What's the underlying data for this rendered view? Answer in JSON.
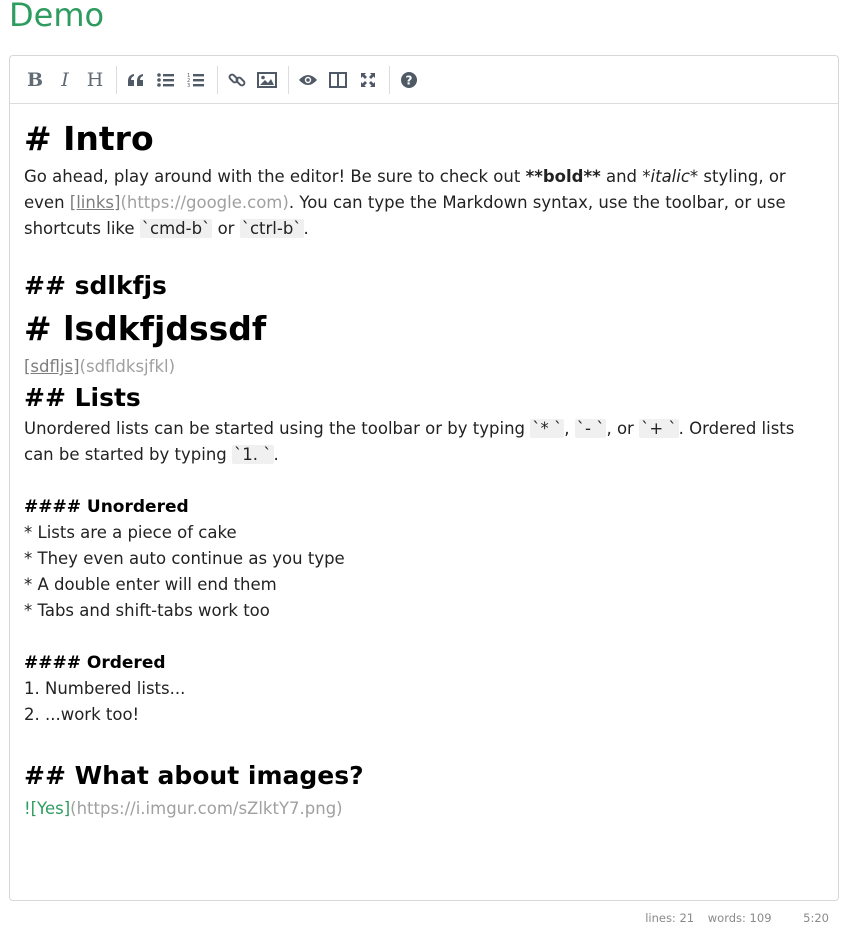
{
  "page": {
    "title": "Demo"
  },
  "toolbar": {
    "bold": "B",
    "italic": "I",
    "heading": "H"
  },
  "editor": {
    "intro_h1": "# Intro",
    "intro_p": {
      "a": "Go ahead, play around with the editor! Be sure to check out ",
      "bold": "**bold**",
      "b": " and ",
      "italic": "*italic*",
      "c": " styling, or even ",
      "link_text": "[links]",
      "link_url": "(https://google.com)",
      "d": ". You can type the Markdown syntax, use the toolbar, or use shortcuts like ",
      "code1": "`cmd-b`",
      "e": " or ",
      "code2": "`ctrl-b`",
      "f": "."
    },
    "h2_sdlkfjs": "## sdlkfjs",
    "h1_lsdk": "# lsdkfjdssdf",
    "link2_text": "[sdfljs]",
    "link2_url": "(sdfldksjfkl)",
    "lists_h2": "## Lists",
    "lists_p": {
      "a": "Unordered lists can be started using the toolbar or by typing ",
      "c1": "`* `",
      "b": ", ",
      "c2": "`- `",
      "c": ", or ",
      "c3": "`+ `",
      "d": ". Ordered lists can be started by typing ",
      "c4": "`1. `",
      "e": "."
    },
    "unordered_h4": "#### Unordered",
    "unordered_items": [
      "* Lists are a piece of cake",
      "* They even auto continue as you type",
      "* A double enter will end them",
      "* Tabs and shift-tabs work too"
    ],
    "ordered_h4": "#### Ordered",
    "ordered_items": [
      "1. Numbered lists...",
      "2. ...work too!"
    ],
    "images_h2": "## What about images?",
    "image_bang": "!",
    "image_alt": "[Yes]",
    "image_url": "(https://i.imgur.com/sZlktY7.png)"
  },
  "statusbar": {
    "lines": "lines: 21",
    "words": "words: 109",
    "cursor": "5:20"
  },
  "colors": {
    "title": "#2e9c5f",
    "muted": "#a0a0a0"
  }
}
